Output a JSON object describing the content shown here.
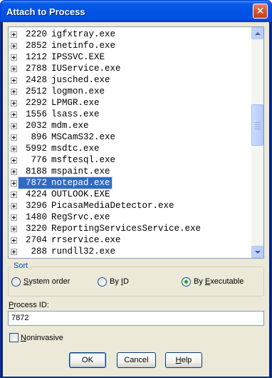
{
  "window": {
    "title": "Attach to Process",
    "close_symbol": "✕"
  },
  "process_list": {
    "selected_index": 14,
    "items": [
      {
        "pid": "2220",
        "name": "igfxtray.exe"
      },
      {
        "pid": "2852",
        "name": "inetinfo.exe"
      },
      {
        "pid": "1212",
        "name": "IPSSVC.EXE"
      },
      {
        "pid": "2788",
        "name": "IUService.exe"
      },
      {
        "pid": "2428",
        "name": "jusched.exe"
      },
      {
        "pid": "2512",
        "name": "logmon.exe"
      },
      {
        "pid": "2292",
        "name": "LPMGR.exe"
      },
      {
        "pid": "1556",
        "name": "lsass.exe"
      },
      {
        "pid": "2032",
        "name": "mdm.exe"
      },
      {
        "pid": "896",
        "name": "MSCamS32.exe"
      },
      {
        "pid": "5992",
        "name": "msdtc.exe"
      },
      {
        "pid": "776",
        "name": "msftesql.exe"
      },
      {
        "pid": "8188",
        "name": "mspaint.exe"
      },
      {
        "pid": "7872",
        "name": "notepad.exe"
      },
      {
        "pid": "4224",
        "name": "OUTLOOK.EXE"
      },
      {
        "pid": "3296",
        "name": "PicasaMediaDetector.exe"
      },
      {
        "pid": "1480",
        "name": "RegSrvc.exe"
      },
      {
        "pid": "3220",
        "name": "ReportingServicesService.exe"
      },
      {
        "pid": "2704",
        "name": "rrservice.exe"
      },
      {
        "pid": "288",
        "name": "rundll32.exe"
      }
    ]
  },
  "sort": {
    "label": "Sort",
    "options": [
      {
        "label_pre": "",
        "accel": "S",
        "label_post": "ystem order",
        "checked": false
      },
      {
        "label_pre": "By ",
        "accel": "I",
        "label_post": "D",
        "checked": false
      },
      {
        "label_pre": "By ",
        "accel": "E",
        "label_post": "xecutable",
        "checked": true
      }
    ]
  },
  "process_id": {
    "label_accel": "P",
    "label_rest": "rocess ID:",
    "value": "7872"
  },
  "noninvasive": {
    "accel": "N",
    "label_rest": "oninvasive",
    "checked": false
  },
  "buttons": {
    "ok": "OK",
    "cancel": "Cancel",
    "help_accel": "H",
    "help_rest": "elp"
  },
  "icons": {
    "close": "close-icon",
    "expander": "plus-box-icon",
    "scroll_up": "chevron-up-icon",
    "scroll_down": "chevron-down-icon"
  },
  "colors": {
    "title_bar": "#0054e3",
    "selection": "#316ac5",
    "group_label": "#0046d5",
    "dialog_bg": "#ece9d8"
  }
}
